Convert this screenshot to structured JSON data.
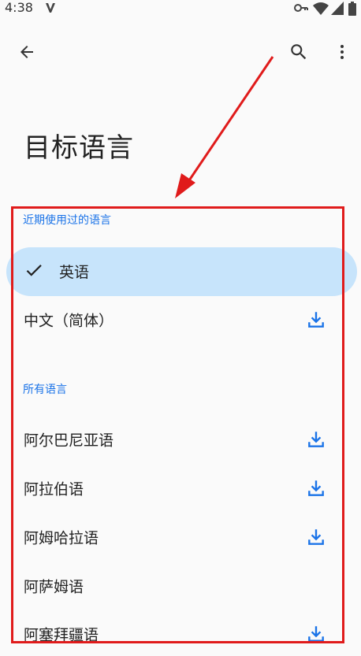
{
  "status_bar": {
    "time": "4:38",
    "icons": [
      "v-logo-icon",
      "key-icon",
      "wifi-icon",
      "signal-icon",
      "battery-icon"
    ]
  },
  "toolbar": {
    "back_icon": "arrow-back-icon",
    "search_icon": "search-icon",
    "more_icon": "more-vert-icon"
  },
  "page": {
    "title": "目标语言"
  },
  "recent": {
    "label": "近期使用过的语言",
    "items": [
      {
        "label": "英语",
        "selected": true,
        "downloadable": false
      },
      {
        "label": "中文（简体）",
        "selected": false,
        "downloadable": true
      }
    ]
  },
  "all": {
    "label": "所有语言",
    "items": [
      {
        "label": "阿尔巴尼亚语",
        "downloadable": true
      },
      {
        "label": "阿拉伯语",
        "downloadable": true
      },
      {
        "label": "阿姆哈拉语",
        "downloadable": true
      },
      {
        "label": "阿萨姆语",
        "downloadable": false
      },
      {
        "label": "阿塞拜疆语",
        "downloadable": true
      }
    ]
  },
  "colors": {
    "accent": "#1a73e8",
    "selected_bg": "#c7e4fb",
    "annotation_red": "#e01b1b"
  }
}
